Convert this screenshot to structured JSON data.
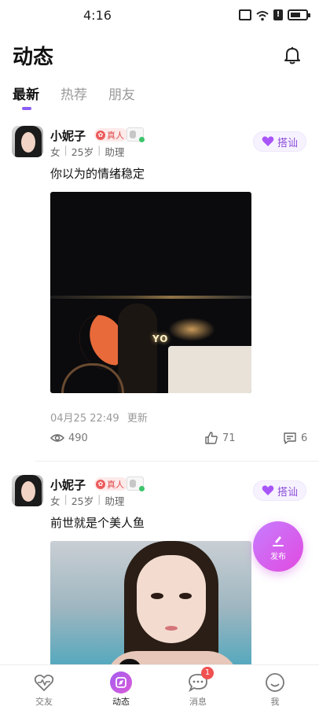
{
  "status_bar": {
    "time": "4:16"
  },
  "header": {
    "title": "动态"
  },
  "tabs": [
    {
      "label": "最新",
      "active": true
    },
    {
      "label": "热荐",
      "active": false
    },
    {
      "label": "朋友",
      "active": false
    }
  ],
  "posts": [
    {
      "user_name": "小妮子",
      "real_badge": "真人",
      "gender": "女",
      "age": "25岁",
      "role": "助理",
      "chat_button": "搭讪",
      "text": "你以为的情绪稳定",
      "photo_sign": "YO",
      "time": "04月25 22:49",
      "updated_label": "更新",
      "views": "490",
      "likes": "71",
      "comments": "6"
    },
    {
      "user_name": "小妮子",
      "real_badge": "真人",
      "gender": "女",
      "age": "25岁",
      "role": "助理",
      "chat_button": "搭讪",
      "text": "前世就是个美人鱼"
    }
  ],
  "fab": {
    "label": "发布"
  },
  "bottom_nav": [
    {
      "label": "交友",
      "icon": "heartbeat-icon"
    },
    {
      "label": "动态",
      "icon": "compass-icon",
      "active": true
    },
    {
      "label": "消息",
      "icon": "chat-bubble-icon",
      "badge": "1"
    },
    {
      "label": "我",
      "icon": "smiley-icon"
    }
  ],
  "colors": {
    "accent": "#8b5cf6",
    "fab_start": "#c77dff",
    "fab_end": "#e14ae0",
    "badge_red": "#f05050"
  }
}
